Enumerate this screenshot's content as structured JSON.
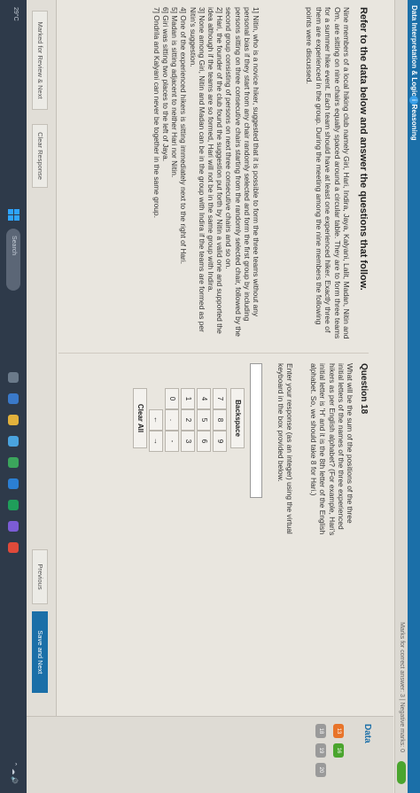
{
  "header": {
    "title": "Data Interpretation & Logical Reasoning",
    "info_icon": "info-icon"
  },
  "subheader": {
    "marks": "Marks for correct answer: 3 | Negative marks: 0"
  },
  "section_heading": "Refer to the data below and answer the questions that follow.",
  "passage": "Nine members of a local hiking club namely Giri, Hari, Indira, Jaya, Kalyani, Lalit, Madan, Nitin and Om, are sitting on nine chairs equally spaced around a circular table. They are to form three teams for a summer hike event. Each team should have at least one experienced hiker. Exactly three of them are experienced in the group. During the meeting among the nine members the following points were discussed.",
  "statements": [
    "1] Nitin, who is a novice hiker, suggested that it is possible to form the three teams without any personal bias if they start from any chair randomly selected and form the first group by including persons sitting on three consecutive chairs starting from the randomly selected chair, followed by the second group consisting of persons on next three consecutive chairs and so on.",
    "2] Hari, the founder of the club found the suggestion put forth by Nitin a valid one and supported the idea although if the teams are so formed, Hari will not be in the same group with Indira.",
    "3] None among Giri, Nitin and Madan can be in the group with Indira if the teams are formed as per Nitin's suggestion.",
    "4] One of the experienced hikers is sitting immediately next to the right of Hari.",
    "5] Madan is sitting adjacent to neither Hari nor Nitin.",
    "6] Giri was sitting two places to the left of Jaya.",
    "7] Ondrila and Kalyani can never be together in the same group."
  ],
  "question": {
    "number": "Question 18",
    "text": "What will be the sum of the positions of the three initial letters of the names of the three experienced hikers as per English alphabet? (For example, Hari's initial letter is 'H' and it is the 8th letter of the English alphabet. So, we should take 8 for Hari.)",
    "instruction": "Enter your response (as an integer) using the virtual keyboard in the box provided below.",
    "answer_value": ""
  },
  "keypad": {
    "backspace": "Backspace",
    "keys": [
      "7",
      "8",
      "9",
      "4",
      "5",
      "6",
      "1",
      "2",
      "3",
      "0",
      ".",
      "-"
    ],
    "left_arrow": "←",
    "right_arrow": "→",
    "clear_all": "Clear All"
  },
  "footer": {
    "mark_review": "Marked for Review & Next",
    "clear_response": "Clear Response",
    "previous": "Previous",
    "save_next": "Save and Next"
  },
  "sidebar": {
    "label": "Data",
    "numbers": [
      "13",
      "16",
      "18",
      "19",
      "20"
    ]
  },
  "taskbar": {
    "search_placeholder": "Search",
    "weather": "29°C"
  },
  "colors": {
    "accent": "#1b6fa8",
    "save_button": "#1b6fa8"
  }
}
